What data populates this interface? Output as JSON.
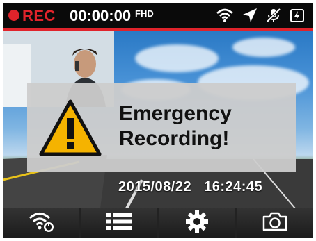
{
  "status_bar": {
    "rec_label": "REC",
    "elapsed": "00:00:00",
    "resolution": "FHD",
    "icons": [
      "wifi-icon",
      "gps-arrow-icon",
      "mic-muted-icon",
      "battery-charging-icon"
    ]
  },
  "alert": {
    "title_line1": "Emergency",
    "title_line2": "Recording!",
    "icon": "warning-triangle-icon"
  },
  "overlay": {
    "date": "2015/08/22",
    "time": "16:24:45"
  },
  "toolbar": {
    "buttons": [
      "wifi-settings-icon",
      "menu-list-icon",
      "settings-gear-icon",
      "camera-snapshot-icon"
    ]
  },
  "colors": {
    "rec_red": "#e0232b",
    "alert_bg": "#cccccc",
    "warning_yellow": "#f5b300"
  }
}
